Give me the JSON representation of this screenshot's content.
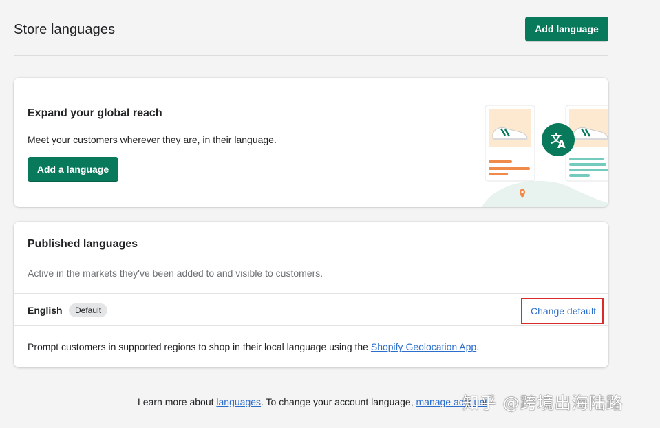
{
  "header": {
    "title": "Store languages",
    "add_button_label": "Add language"
  },
  "reach_card": {
    "title": "Expand your global reach",
    "text": "Meet your customers wherever they are, in their language.",
    "button_label": "Add a language"
  },
  "published_card": {
    "title": "Published languages",
    "subtitle": "Active in the markets they've been added to and visible to customers.",
    "languages": [
      {
        "name": "English",
        "badge": "Default",
        "action_label": "Change default"
      }
    ],
    "prompt_prefix": "Prompt customers in supported regions to shop in their local language using the ",
    "prompt_link": "Shopify Geolocation App",
    "prompt_suffix": "."
  },
  "footer": {
    "prefix": "Learn more about ",
    "languages_link": "languages",
    "middle": ". To change your account language, ",
    "account_link": "manage account"
  },
  "watermark": "知乎 @跨境出海陆路",
  "colors": {
    "primary": "#087a5b",
    "link": "#2c6ecb",
    "highlight_box": "#d82c2c"
  },
  "icons": [
    "translate-icon",
    "sneaker-icon",
    "location-pin-icon"
  ]
}
